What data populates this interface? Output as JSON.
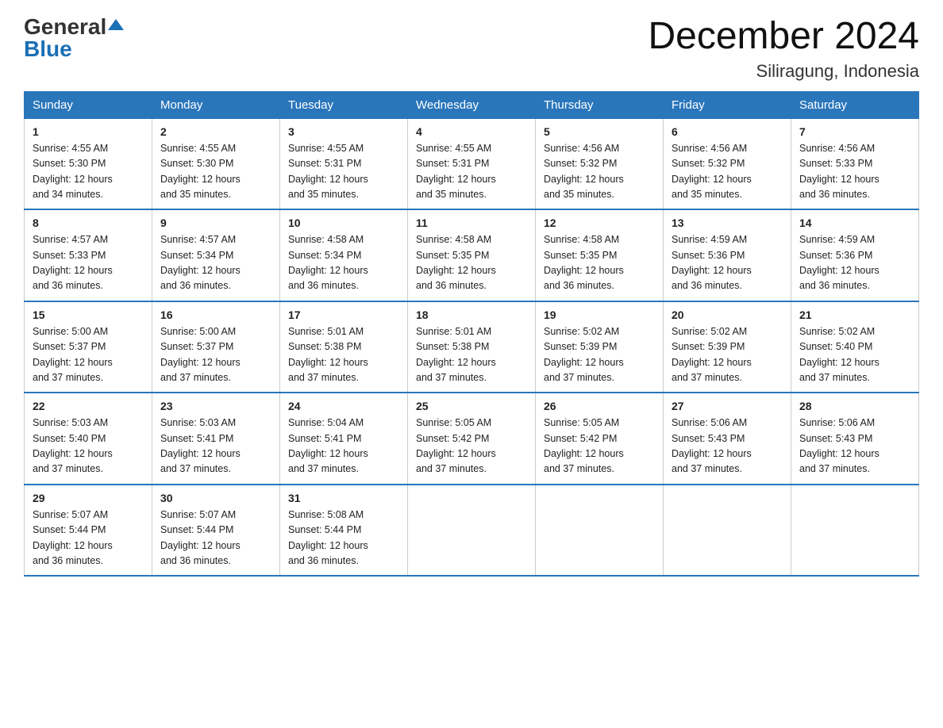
{
  "logo": {
    "general": "General",
    "blue": "Blue"
  },
  "title": "December 2024",
  "subtitle": "Siliragung, Indonesia",
  "days_header": [
    "Sunday",
    "Monday",
    "Tuesday",
    "Wednesday",
    "Thursday",
    "Friday",
    "Saturday"
  ],
  "weeks": [
    [
      {
        "day": "1",
        "sunrise": "4:55 AM",
        "sunset": "5:30 PM",
        "daylight": "12 hours and 34 minutes."
      },
      {
        "day": "2",
        "sunrise": "4:55 AM",
        "sunset": "5:30 PM",
        "daylight": "12 hours and 35 minutes."
      },
      {
        "day": "3",
        "sunrise": "4:55 AM",
        "sunset": "5:31 PM",
        "daylight": "12 hours and 35 minutes."
      },
      {
        "day": "4",
        "sunrise": "4:55 AM",
        "sunset": "5:31 PM",
        "daylight": "12 hours and 35 minutes."
      },
      {
        "day": "5",
        "sunrise": "4:56 AM",
        "sunset": "5:32 PM",
        "daylight": "12 hours and 35 minutes."
      },
      {
        "day": "6",
        "sunrise": "4:56 AM",
        "sunset": "5:32 PM",
        "daylight": "12 hours and 35 minutes."
      },
      {
        "day": "7",
        "sunrise": "4:56 AM",
        "sunset": "5:33 PM",
        "daylight": "12 hours and 36 minutes."
      }
    ],
    [
      {
        "day": "8",
        "sunrise": "4:57 AM",
        "sunset": "5:33 PM",
        "daylight": "12 hours and 36 minutes."
      },
      {
        "day": "9",
        "sunrise": "4:57 AM",
        "sunset": "5:34 PM",
        "daylight": "12 hours and 36 minutes."
      },
      {
        "day": "10",
        "sunrise": "4:58 AM",
        "sunset": "5:34 PM",
        "daylight": "12 hours and 36 minutes."
      },
      {
        "day": "11",
        "sunrise": "4:58 AM",
        "sunset": "5:35 PM",
        "daylight": "12 hours and 36 minutes."
      },
      {
        "day": "12",
        "sunrise": "4:58 AM",
        "sunset": "5:35 PM",
        "daylight": "12 hours and 36 minutes."
      },
      {
        "day": "13",
        "sunrise": "4:59 AM",
        "sunset": "5:36 PM",
        "daylight": "12 hours and 36 minutes."
      },
      {
        "day": "14",
        "sunrise": "4:59 AM",
        "sunset": "5:36 PM",
        "daylight": "12 hours and 36 minutes."
      }
    ],
    [
      {
        "day": "15",
        "sunrise": "5:00 AM",
        "sunset": "5:37 PM",
        "daylight": "12 hours and 37 minutes."
      },
      {
        "day": "16",
        "sunrise": "5:00 AM",
        "sunset": "5:37 PM",
        "daylight": "12 hours and 37 minutes."
      },
      {
        "day": "17",
        "sunrise": "5:01 AM",
        "sunset": "5:38 PM",
        "daylight": "12 hours and 37 minutes."
      },
      {
        "day": "18",
        "sunrise": "5:01 AM",
        "sunset": "5:38 PM",
        "daylight": "12 hours and 37 minutes."
      },
      {
        "day": "19",
        "sunrise": "5:02 AM",
        "sunset": "5:39 PM",
        "daylight": "12 hours and 37 minutes."
      },
      {
        "day": "20",
        "sunrise": "5:02 AM",
        "sunset": "5:39 PM",
        "daylight": "12 hours and 37 minutes."
      },
      {
        "day": "21",
        "sunrise": "5:02 AM",
        "sunset": "5:40 PM",
        "daylight": "12 hours and 37 minutes."
      }
    ],
    [
      {
        "day": "22",
        "sunrise": "5:03 AM",
        "sunset": "5:40 PM",
        "daylight": "12 hours and 37 minutes."
      },
      {
        "day": "23",
        "sunrise": "5:03 AM",
        "sunset": "5:41 PM",
        "daylight": "12 hours and 37 minutes."
      },
      {
        "day": "24",
        "sunrise": "5:04 AM",
        "sunset": "5:41 PM",
        "daylight": "12 hours and 37 minutes."
      },
      {
        "day": "25",
        "sunrise": "5:05 AM",
        "sunset": "5:42 PM",
        "daylight": "12 hours and 37 minutes."
      },
      {
        "day": "26",
        "sunrise": "5:05 AM",
        "sunset": "5:42 PM",
        "daylight": "12 hours and 37 minutes."
      },
      {
        "day": "27",
        "sunrise": "5:06 AM",
        "sunset": "5:43 PM",
        "daylight": "12 hours and 37 minutes."
      },
      {
        "day": "28",
        "sunrise": "5:06 AM",
        "sunset": "5:43 PM",
        "daylight": "12 hours and 37 minutes."
      }
    ],
    [
      {
        "day": "29",
        "sunrise": "5:07 AM",
        "sunset": "5:44 PM",
        "daylight": "12 hours and 36 minutes."
      },
      {
        "day": "30",
        "sunrise": "5:07 AM",
        "sunset": "5:44 PM",
        "daylight": "12 hours and 36 minutes."
      },
      {
        "day": "31",
        "sunrise": "5:08 AM",
        "sunset": "5:44 PM",
        "daylight": "12 hours and 36 minutes."
      },
      null,
      null,
      null,
      null
    ]
  ],
  "labels": {
    "sunrise": "Sunrise:",
    "sunset": "Sunset:",
    "daylight": "Daylight:"
  }
}
